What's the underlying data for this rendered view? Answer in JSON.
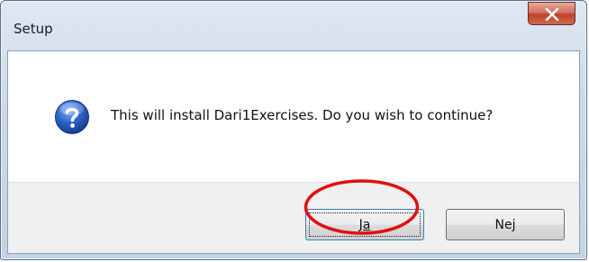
{
  "window": {
    "title": "Setup",
    "close_icon": "close-icon"
  },
  "dialog": {
    "icon": "question-icon",
    "message": "This will install Dari1Exercises. Do you wish to continue?"
  },
  "buttons": {
    "yes_label": "Ja",
    "no_label": "Nej"
  },
  "colors": {
    "annotation": "#e01010",
    "close_button": "#c0412a",
    "question_icon": "#1f57b8"
  }
}
